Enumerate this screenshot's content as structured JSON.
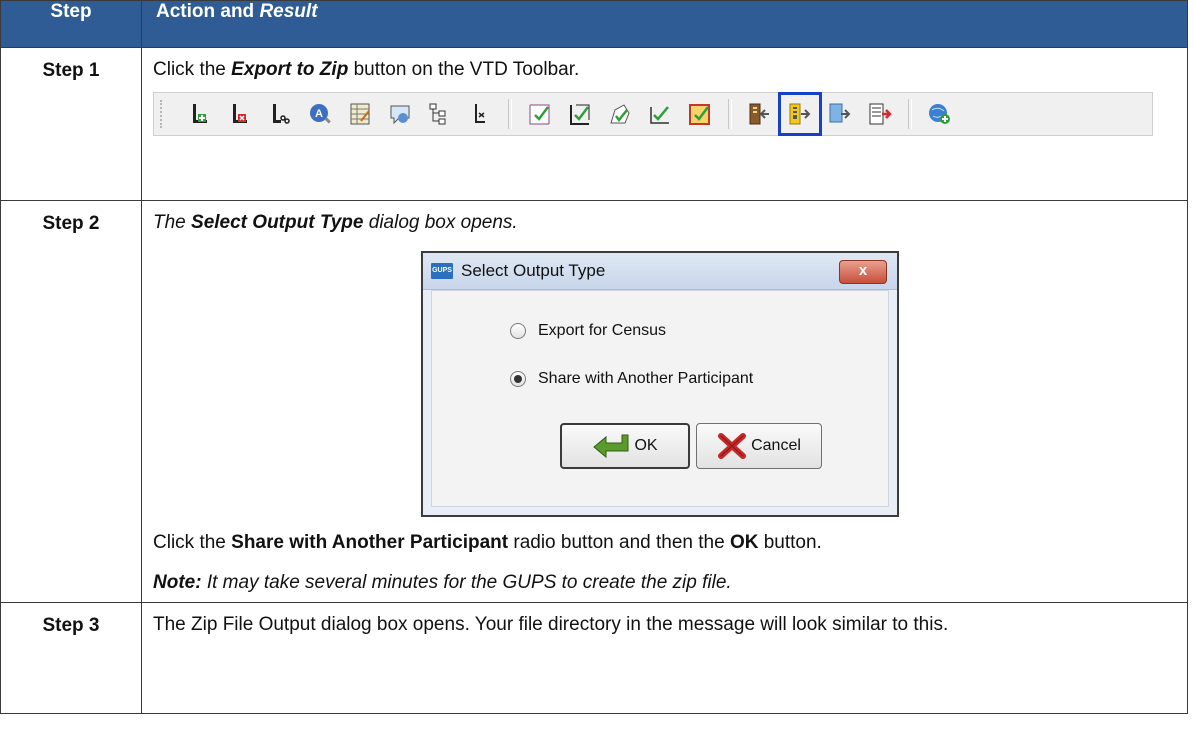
{
  "header": {
    "step": "Step",
    "action": "Action and ",
    "result": "Result"
  },
  "rows": [
    {
      "step": "Step 1",
      "pre": "Click the ",
      "bold_italic": "Export to Zip",
      "post": " button on the VTD Toolbar."
    },
    {
      "step": "Step 2",
      "intro_pre": "The ",
      "intro_bold": "Select Output Type",
      "intro_post": " dialog box opens.",
      "instr_pre": "Click the ",
      "instr_bold1": "Share with Another Participant",
      "instr_mid": " radio button and then the ",
      "instr_bold2": "OK",
      "instr_post": " button.",
      "note_label": "Note:",
      "note_text": " It may take several minutes for the GUPS to create the zip file."
    },
    {
      "step": "Step 3",
      "text": "The Zip File Output dialog box opens. Your file directory in the message will look similar to this."
    }
  ],
  "dialog": {
    "logo": "GUPS",
    "title": "Select Output Type",
    "close": "x",
    "option1": "Export for Census",
    "option2": "Share with Another Participant",
    "selected": "Share with Another Participant",
    "ok": "OK",
    "cancel": "Cancel"
  },
  "toolbar": {
    "icons": [
      "add-layer-icon",
      "remove-layer-icon",
      "split-icon",
      "identify-icon",
      "table-icon",
      "map-tip-icon",
      "hierarchy-icon",
      "split-line-icon",
      "select-box-icon",
      "select-icon",
      "polygon-select-icon",
      "check-icon",
      "review-icon",
      "import-icon",
      "export-to-zip-icon",
      "export-icon",
      "report-icon",
      "globe-add-icon"
    ],
    "highlighted": "export-to-zip-icon"
  }
}
